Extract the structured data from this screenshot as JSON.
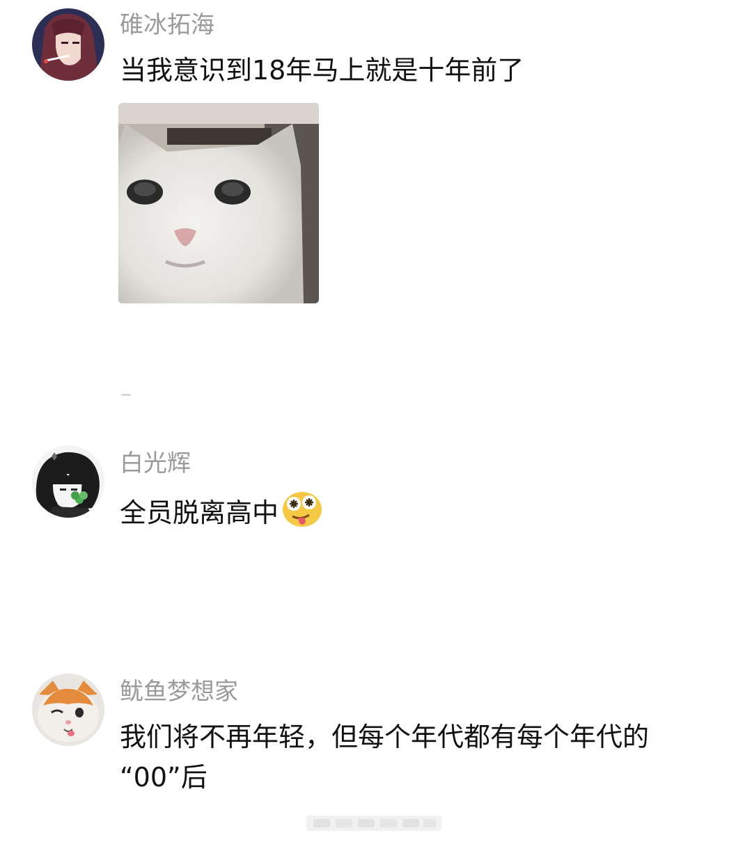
{
  "comments": [
    {
      "username": "碓冰拓海",
      "text_lines": [
        "当我意识到18年马上就是十年前了"
      ]
    },
    {
      "username": "白光辉",
      "text_lines": [
        "全员脱离高中"
      ]
    },
    {
      "username": "鱿鱼梦想家",
      "text_lines": [
        "我们将不再年轻，但每个年代都有每个年代的",
        "“00”后"
      ]
    }
  ],
  "icons": {
    "avatar_1": "anime-girl-avatar",
    "avatar_2": "anime-boy-avatar",
    "avatar_3": "kitten-avatar",
    "meme": "white-cat-meme-image",
    "emoji": "dizzy-tongue-emoji"
  },
  "colors": {
    "username": "#9a9a9a",
    "text": "#111111",
    "background": "#ffffff"
  }
}
